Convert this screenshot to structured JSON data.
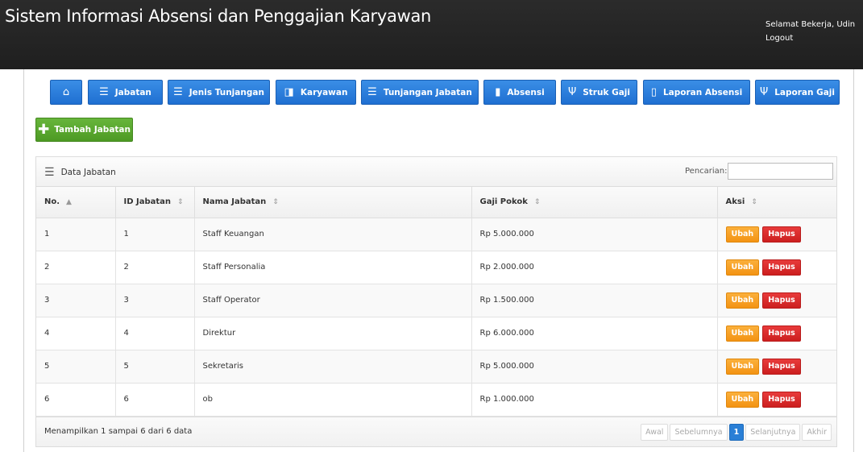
{
  "header": {
    "title": "Sistem Informasi Absensi dan Penggajian Karyawan",
    "greeting": "Selamat Bekerja, Udin",
    "logout": "Logout"
  },
  "nav": {
    "home_icon": "home-icon",
    "items": [
      {
        "label": "Jabatan",
        "icon": "list-icon"
      },
      {
        "label": "Jenis Tunjangan",
        "icon": "list-icon"
      },
      {
        "label": "Karyawan",
        "icon": "book-icon"
      },
      {
        "label": "Tunjangan Jabatan",
        "icon": "list-icon"
      },
      {
        "label": "Absensi",
        "icon": "file-icon"
      },
      {
        "label": "Struk Gaji",
        "icon": "microphone-icon"
      },
      {
        "label": "Laporan Absensi",
        "icon": "file-outline-icon"
      },
      {
        "label": "Laporan Gaji",
        "icon": "microphone-icon"
      }
    ]
  },
  "actions": {
    "add_label": "Tambah Jabatan"
  },
  "table": {
    "title": "Data Jabatan",
    "search_label": "Pencarian:",
    "search_value": "",
    "columns": [
      "No.",
      "ID Jabatan",
      "Nama Jabatan",
      "Gaji Pokok",
      "Aksi"
    ],
    "rows": [
      {
        "no": "1",
        "id": "1",
        "name": "Staff Keuangan",
        "salary": "Rp 5.000.000"
      },
      {
        "no": "2",
        "id": "2",
        "name": "Staff Personalia",
        "salary": "Rp 2.000.000"
      },
      {
        "no": "3",
        "id": "3",
        "name": "Staff Operator",
        "salary": "Rp 1.500.000"
      },
      {
        "no": "4",
        "id": "4",
        "name": "Direktur",
        "salary": "Rp 6.000.000"
      },
      {
        "no": "5",
        "id": "5",
        "name": "Sekretaris",
        "salary": "Rp 5.000.000"
      },
      {
        "no": "6",
        "id": "6",
        "name": "ob",
        "salary": "Rp 1.000.000"
      }
    ],
    "edit_label": "Ubah",
    "delete_label": "Hapus",
    "info": "Menampilkan 1 sampai 6 dari 6 data",
    "pagination": {
      "first": "Awal",
      "prev": "Sebelumnya",
      "current": "1",
      "next": "Selanjutnya",
      "last": "Akhir"
    }
  },
  "colors": {
    "nav_blue": "#2a7fd6",
    "add_green": "#5aa82f",
    "edit_orange": "#f5a020",
    "delete_red": "#d92b2b",
    "topbar": "#252525"
  }
}
